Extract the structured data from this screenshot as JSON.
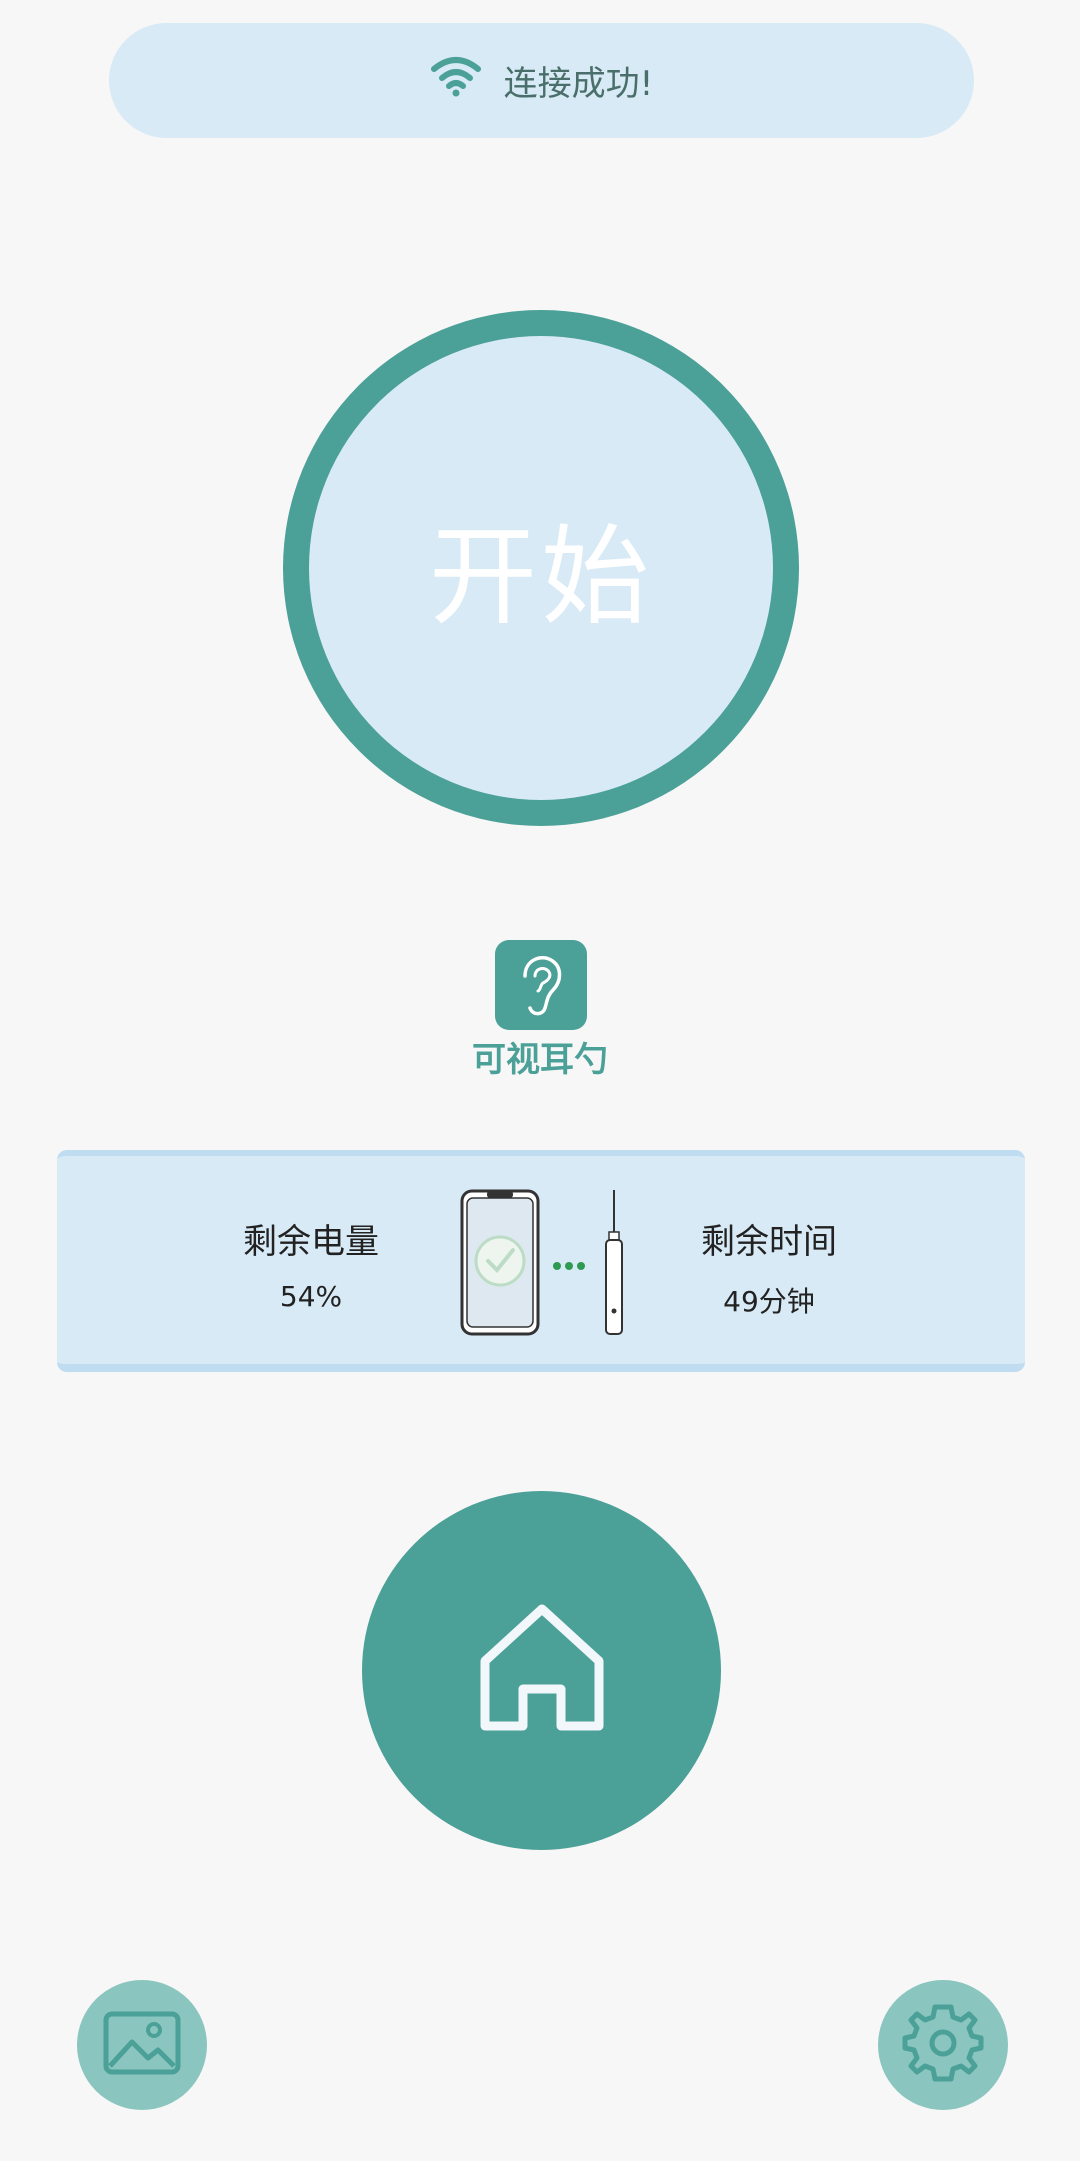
{
  "header": {
    "status_text": "连接成功!",
    "icon": "wifi-icon"
  },
  "main": {
    "start_label": "开始"
  },
  "device": {
    "icon": "ear-icon",
    "name": "可视耳勺"
  },
  "info": {
    "battery_label": "剩余电量",
    "battery_value": "54%",
    "time_label": "剩余时间",
    "time_value": "49分钟"
  },
  "nav": {
    "home_icon": "home-icon",
    "gallery_icon": "image-icon",
    "settings_icon": "gear-icon"
  },
  "colors": {
    "accent": "#4ba098",
    "panel": "#d8eaf6",
    "light_accent": "#8ac6bf",
    "background": "#f7f7f7"
  }
}
